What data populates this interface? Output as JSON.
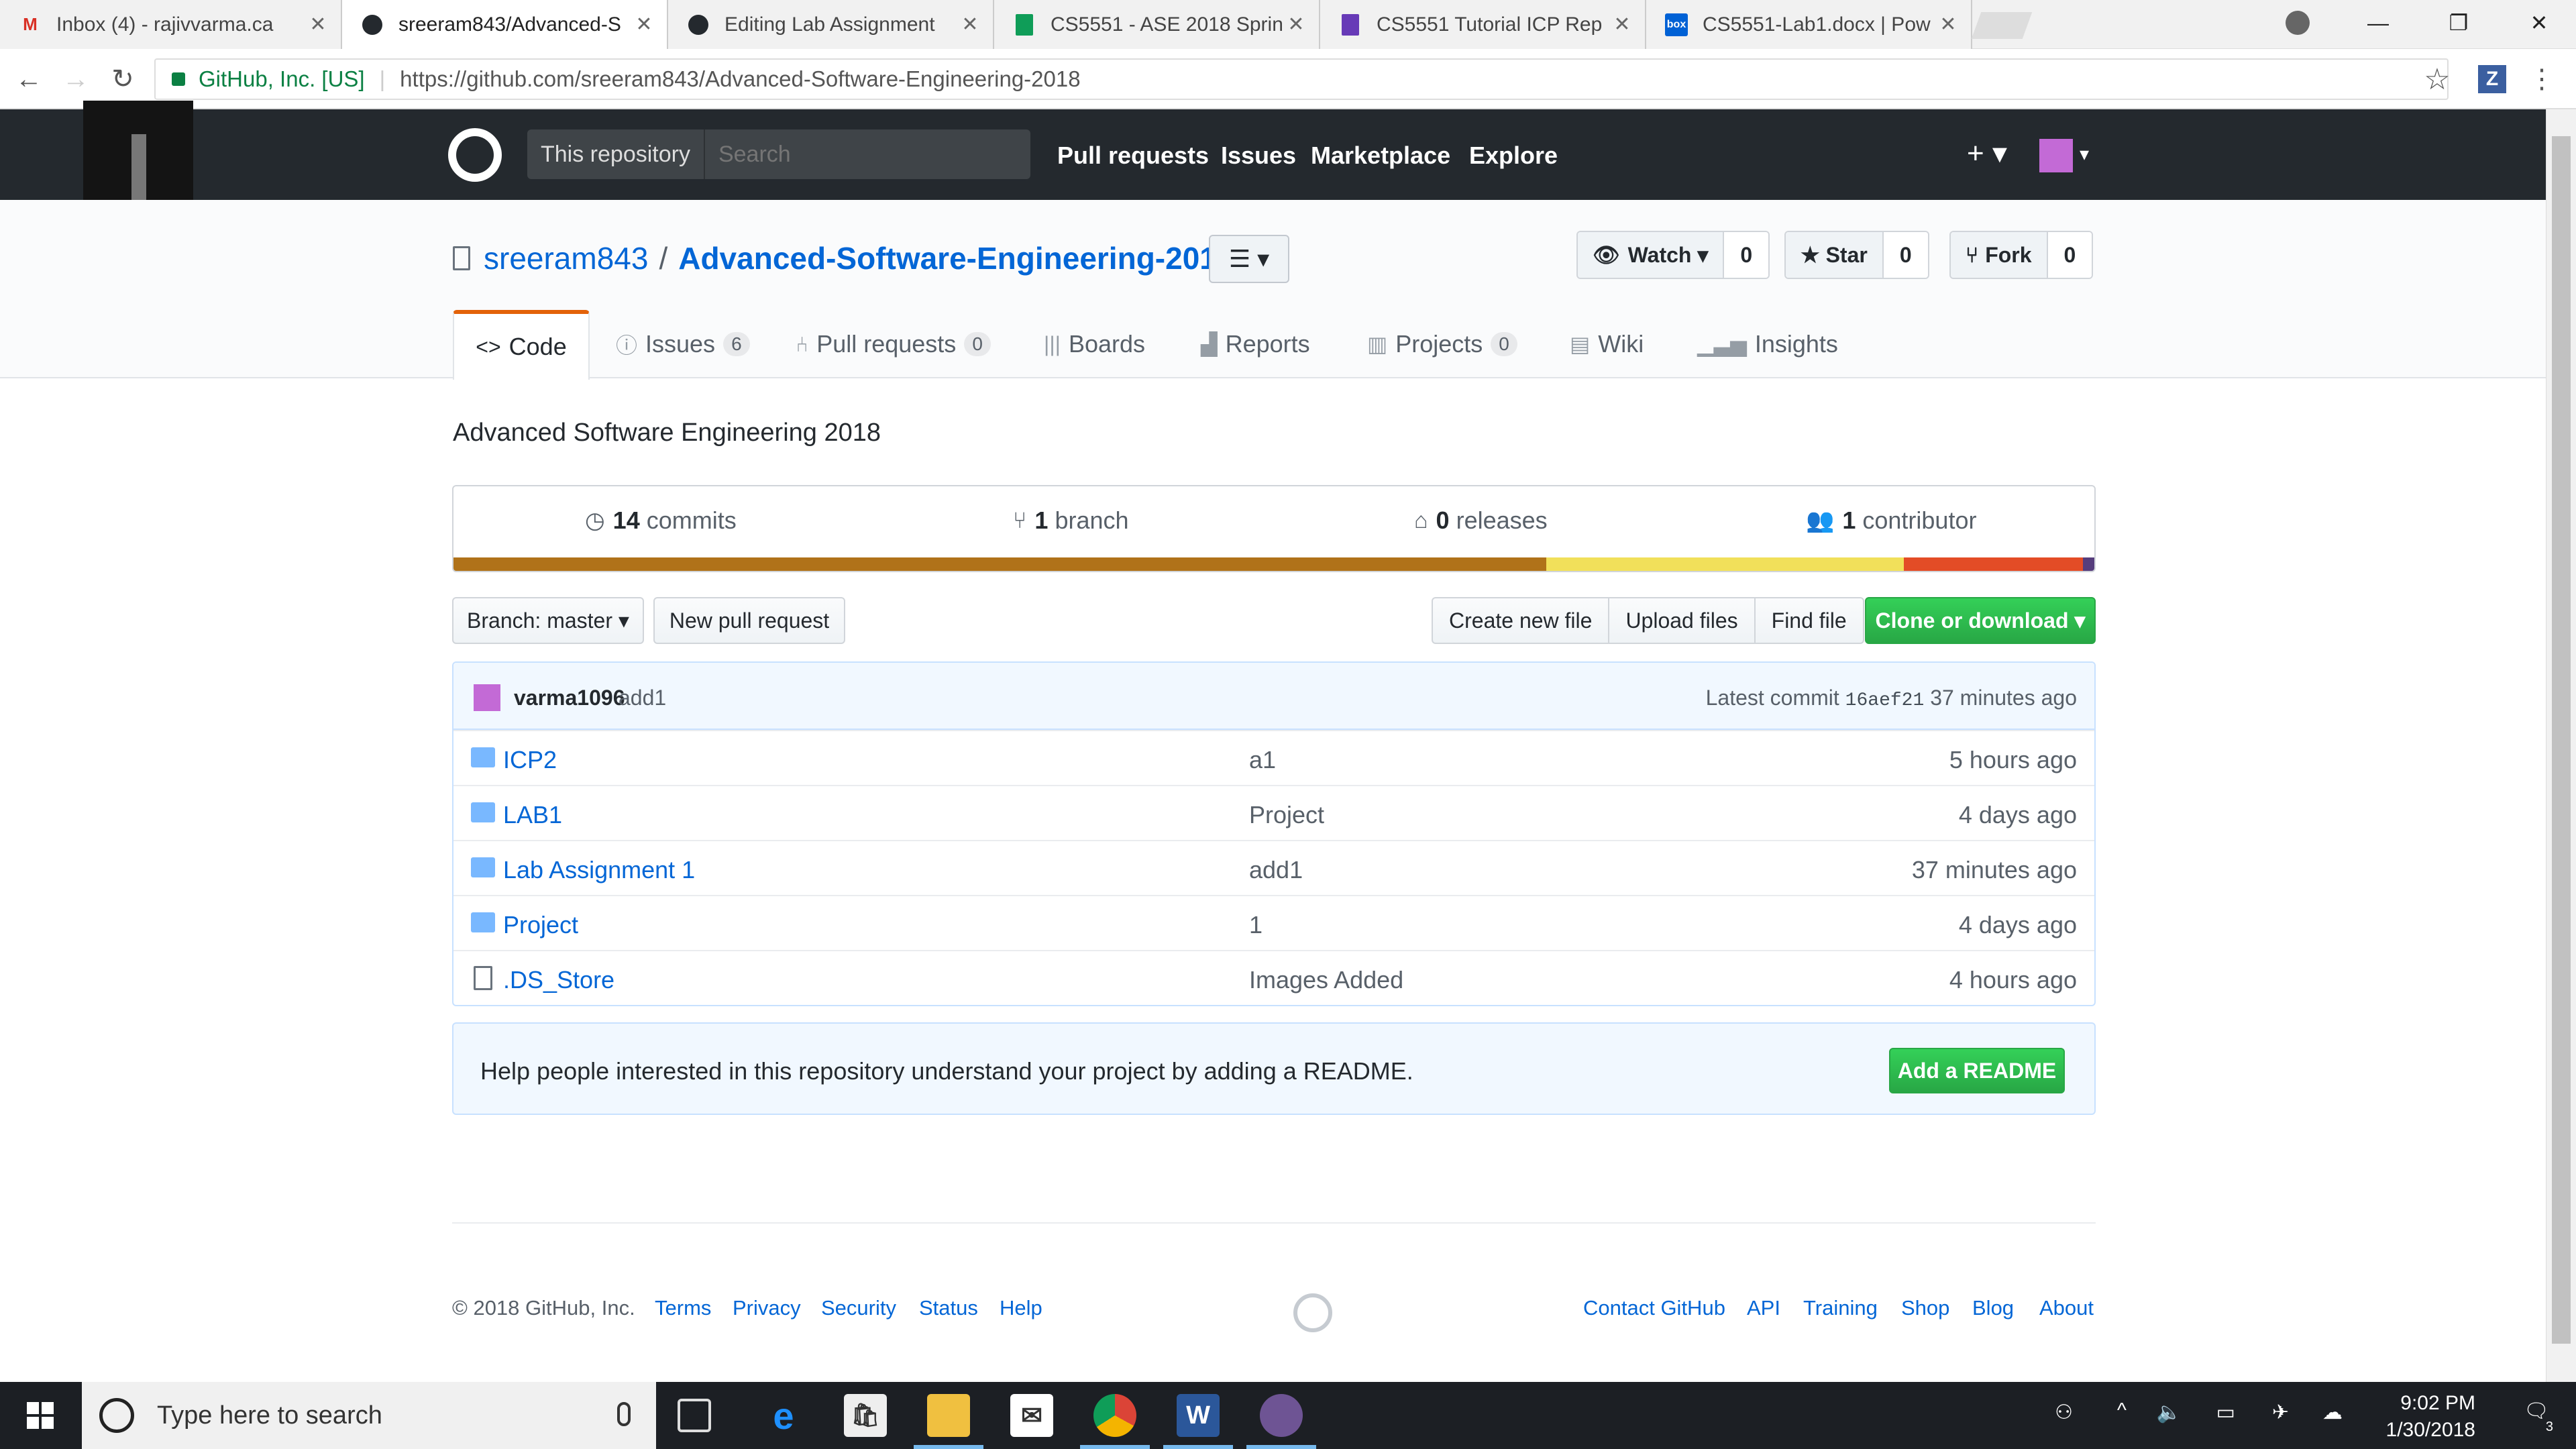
{
  "browser": {
    "tabs": [
      {
        "title": "Inbox (4) - rajivvarma.ca",
        "favicon": "gmail-icon",
        "color": "#d93025"
      },
      {
        "title": "sreeram843/Advanced-S",
        "favicon": "github-icon",
        "color": "#24292e"
      },
      {
        "title": "Editing Lab Assignment",
        "favicon": "github-icon",
        "color": "#24292e"
      },
      {
        "title": "CS5551 - ASE 2018 Sprin",
        "favicon": "sheets-icon",
        "color": "#0f9d58"
      },
      {
        "title": "CS5551 Tutorial ICP Rep",
        "favicon": "forms-icon",
        "color": "#673ab7"
      },
      {
        "title": "CS5551-Lab1.docx | Pow",
        "favicon": "box-icon",
        "color": "#0061d5"
      }
    ],
    "site_identity": "GitHub, Inc. [US]",
    "url": "https://github.com/sreeram843/Advanced-Software-Engineering-2018"
  },
  "github_header": {
    "search_scope": "This repository",
    "search_placeholder": "Search",
    "nav": [
      "Pull requests",
      "Issues",
      "Marketplace",
      "Explore"
    ],
    "plus": "+ ▾",
    "avatar_caret": "▾"
  },
  "repo": {
    "owner": "sreeram843",
    "name": "Advanced-Software-Engineering-2018",
    "watch_label": "Watch ▾",
    "watch_count": "0",
    "star_label": "★ Star",
    "star_count": "0",
    "fork_label": "Fork",
    "fork_count": "0",
    "tabs": {
      "code": "Code",
      "issues": "Issues",
      "issues_count": "6",
      "pulls": "Pull requests",
      "pulls_count": "0",
      "boards": "Boards",
      "reports": "Reports",
      "projects": "Projects",
      "projects_count": "0",
      "wiki": "Wiki",
      "insights": "Insights"
    },
    "description": "Advanced Software Engineering 2018",
    "summary": {
      "commits_num": "14",
      "commits_label": "commits",
      "branch_num": "1",
      "branch_label": "branch",
      "releases_num": "0",
      "releases_label": "releases",
      "contributor_num": "1",
      "contributor_label": "contributor"
    },
    "language_bar": [
      {
        "color": "#b07219",
        "fraction": 0.666
      },
      {
        "color": "#f1e05a",
        "fraction": 0.218
      },
      {
        "color": "#e34c26",
        "fraction": 0.109
      },
      {
        "color": "#563d7c",
        "fraction": 0.007
      }
    ],
    "branch_button": "Branch: master ▾",
    "new_pr_button": "New pull request",
    "create_file": "Create new file",
    "upload_files": "Upload files",
    "find_file": "Find file",
    "clone_button": "Clone or download ▾",
    "latest_commit": {
      "author": "varma1096",
      "message": "add1",
      "label": "Latest commit",
      "sha": "16aef21",
      "age": "37 minutes ago"
    },
    "files": [
      {
        "name": "ICP2",
        "type": "dir",
        "message": "a1",
        "age": "5 hours ago"
      },
      {
        "name": "LAB1",
        "type": "dir",
        "message": "Project",
        "age": "4 days ago"
      },
      {
        "name": "Lab Assignment 1",
        "type": "dir",
        "message": "add1",
        "age": "37 minutes ago"
      },
      {
        "name": "Project",
        "type": "dir",
        "message": "1",
        "age": "4 days ago"
      },
      {
        "name": ".DS_Store",
        "type": "file",
        "message": "Images Added",
        "age": "4 hours ago"
      }
    ],
    "readme_prompt": "Help people interested in this repository understand your project by adding a README.",
    "readme_button": "Add a README"
  },
  "footer": {
    "copyright": "© 2018 GitHub, Inc.",
    "left_links": [
      "Terms",
      "Privacy",
      "Security",
      "Status",
      "Help"
    ],
    "right_links": [
      "Contact GitHub",
      "API",
      "Training",
      "Shop",
      "Blog",
      "About"
    ]
  },
  "taskbar": {
    "search_placeholder": "Type here to search",
    "time": "9:02 PM",
    "date": "1/30/2018",
    "notifications": "3"
  }
}
